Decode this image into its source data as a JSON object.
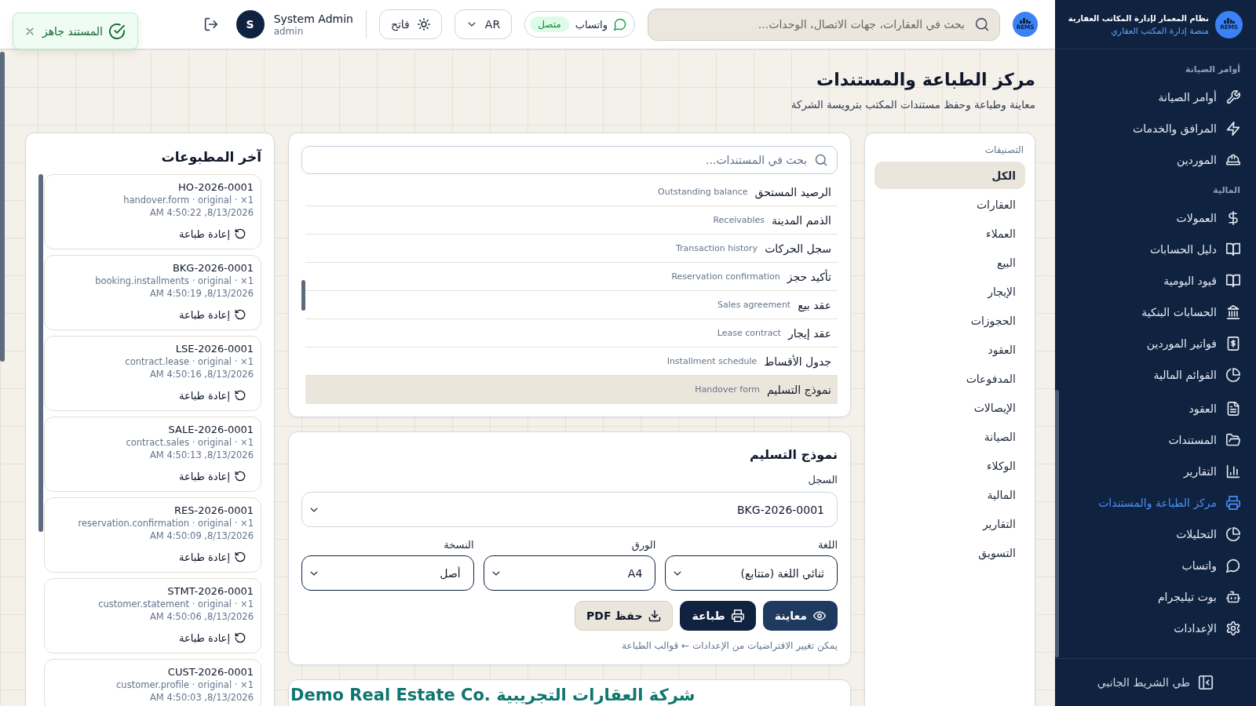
{
  "toast": {
    "message": "المستند جاهز"
  },
  "header": {
    "logo_text": "REMS",
    "search": {
      "placeholder": "بحث في العقارات، جهات الاتصال، الوحدات..."
    },
    "whatsapp": {
      "label": "واتساب",
      "status": "متصل"
    },
    "language": "AR",
    "theme": "فاتح",
    "user": {
      "name": "System Admin",
      "role": "admin",
      "initial": "S"
    }
  },
  "page": {
    "title": "مركز الطباعة والمستندات",
    "subtitle": "معاينة وطباعة وحفظ مستندات المكتب بترويسة الشركة"
  },
  "categories": {
    "title": "التصنيفات",
    "items": [
      {
        "label": "الكل",
        "selected": true
      },
      {
        "label": "العقارات",
        "selected": false
      },
      {
        "label": "العملاء",
        "selected": false
      },
      {
        "label": "البيع",
        "selected": false
      },
      {
        "label": "الإيجار",
        "selected": false
      },
      {
        "label": "الحجوزات",
        "selected": false
      },
      {
        "label": "العقود",
        "selected": false
      },
      {
        "label": "المدفوعات",
        "selected": false
      },
      {
        "label": "الإيصالات",
        "selected": false
      },
      {
        "label": "الصيانة",
        "selected": false
      },
      {
        "label": "الوكلاء",
        "selected": false
      },
      {
        "label": "المالية",
        "selected": false
      },
      {
        "label": "التقارير",
        "selected": false
      },
      {
        "label": "التسويق",
        "selected": false
      }
    ]
  },
  "documents": {
    "search": {
      "placeholder": "بحث في المستندات..."
    },
    "items": [
      {
        "title": "الرصيد المستحق",
        "subtitle": "Outstanding balance",
        "selected": false
      },
      {
        "title": "الذمم المدينة",
        "subtitle": "Receivables",
        "selected": false
      },
      {
        "title": "سجل الحركات",
        "subtitle": "Transaction history",
        "selected": false
      },
      {
        "title": "تأكيد حجز",
        "subtitle": "Reservation confirmation",
        "selected": false
      },
      {
        "title": "عقد بيع",
        "subtitle": "Sales agreement",
        "selected": false
      },
      {
        "title": "عقد إيجار",
        "subtitle": "Lease contract",
        "selected": false
      },
      {
        "title": "جدول الأقساط",
        "subtitle": "Installment schedule",
        "selected": false
      },
      {
        "title": "نموذج التسليم",
        "subtitle": "Handover form",
        "selected": true
      }
    ]
  },
  "form": {
    "title": "نموذج التسليم",
    "record": {
      "label": "السجل",
      "value": "BKG-2026-0001"
    },
    "options": [
      {
        "label": "اللغة",
        "value": "ثنائي اللغة (متتابع)"
      },
      {
        "label": "الورق",
        "value": "A4"
      },
      {
        "label": "النسخة",
        "value": "أصل"
      }
    ],
    "buttons": [
      {
        "kind": "preview",
        "label": "معاينة"
      },
      {
        "kind": "print",
        "label": "طباعة"
      },
      {
        "kind": "download",
        "label": "حفظ PDF"
      }
    ],
    "note": "يمكن تغيير الافتراضيات من الإعدادات ← قوالب الطباعة"
  },
  "letterhead": {
    "company": "Demo Real Estate Co. شركة العقارات التجريبية"
  },
  "recent": {
    "title": "آخر المطبوعات",
    "items": [
      {
        "code": "HO-2026-0001",
        "meta": "handover.form · original · ×1",
        "time": "8/13/2026, 4:50:22 AM",
        "action": "إعادة طباعة"
      },
      {
        "code": "BKG-2026-0001",
        "meta": "booking.installments · original · ×1",
        "time": "8/13/2026, 4:50:19 AM",
        "action": "إعادة طباعة"
      },
      {
        "code": "LSE-2026-0001",
        "meta": "contract.lease · original · ×1",
        "time": "8/13/2026, 4:50:16 AM",
        "action": "إعادة طباعة"
      },
      {
        "code": "SALE-2026-0001",
        "meta": "contract.sales · original · ×1",
        "time": "8/13/2026, 4:50:13 AM",
        "action": "إعادة طباعة"
      },
      {
        "code": "RES-2026-0001",
        "meta": "reservation.confirmation · original · ×1",
        "time": "8/13/2026, 4:50:09 AM",
        "action": "إعادة طباعة"
      },
      {
        "code": "STMT-2026-0001",
        "meta": "customer.statement · original · ×1",
        "time": "8/13/2026, 4:50:06 AM",
        "action": "إعادة طباعة"
      },
      {
        "code": "CUST-2026-0001",
        "meta": "customer.profile · original · ×1",
        "time": "8/13/2026, 4:50:03 AM"
      }
    ]
  },
  "sidebar": {
    "logo_text": "REMS",
    "title": "نظام المعمار لإدارة المكاتب العقارية",
    "subtitle": "منصة إدارة المكتب العقاري",
    "sections": [
      {
        "label": "أوامر الصيانة",
        "items": [
          {
            "label": "أوامر الصيانة",
            "selected": false
          },
          {
            "label": "المرافق والخدمات",
            "selected": false
          },
          {
            "label": "الموردين",
            "selected": false
          }
        ]
      },
      {
        "label": "المالية",
        "items": [
          {
            "label": "العمولات",
            "selected": false
          },
          {
            "label": "دليل الحسابات",
            "selected": false
          },
          {
            "label": "قيود اليومية",
            "selected": false
          },
          {
            "label": "الحسابات البنكية",
            "selected": false
          },
          {
            "label": "فواتير الموردين",
            "selected": false
          },
          {
            "label": "القوائم المالية",
            "selected": false
          }
        ]
      },
      {
        "items": [
          {
            "label": "العقود",
            "selected": false
          },
          {
            "label": "المستندات",
            "selected": false
          },
          {
            "label": "التقارير",
            "selected": false
          },
          {
            "label": "مركز الطباعة والمستندات",
            "selected": true
          },
          {
            "label": "التحليلات",
            "selected": false
          },
          {
            "label": "واتساب",
            "selected": false
          },
          {
            "label": "بوت تيليجرام",
            "selected": false
          },
          {
            "label": "الإعدادات",
            "selected": false
          }
        ]
      }
    ],
    "collapse": "طي الشريط الجانبي"
  }
}
